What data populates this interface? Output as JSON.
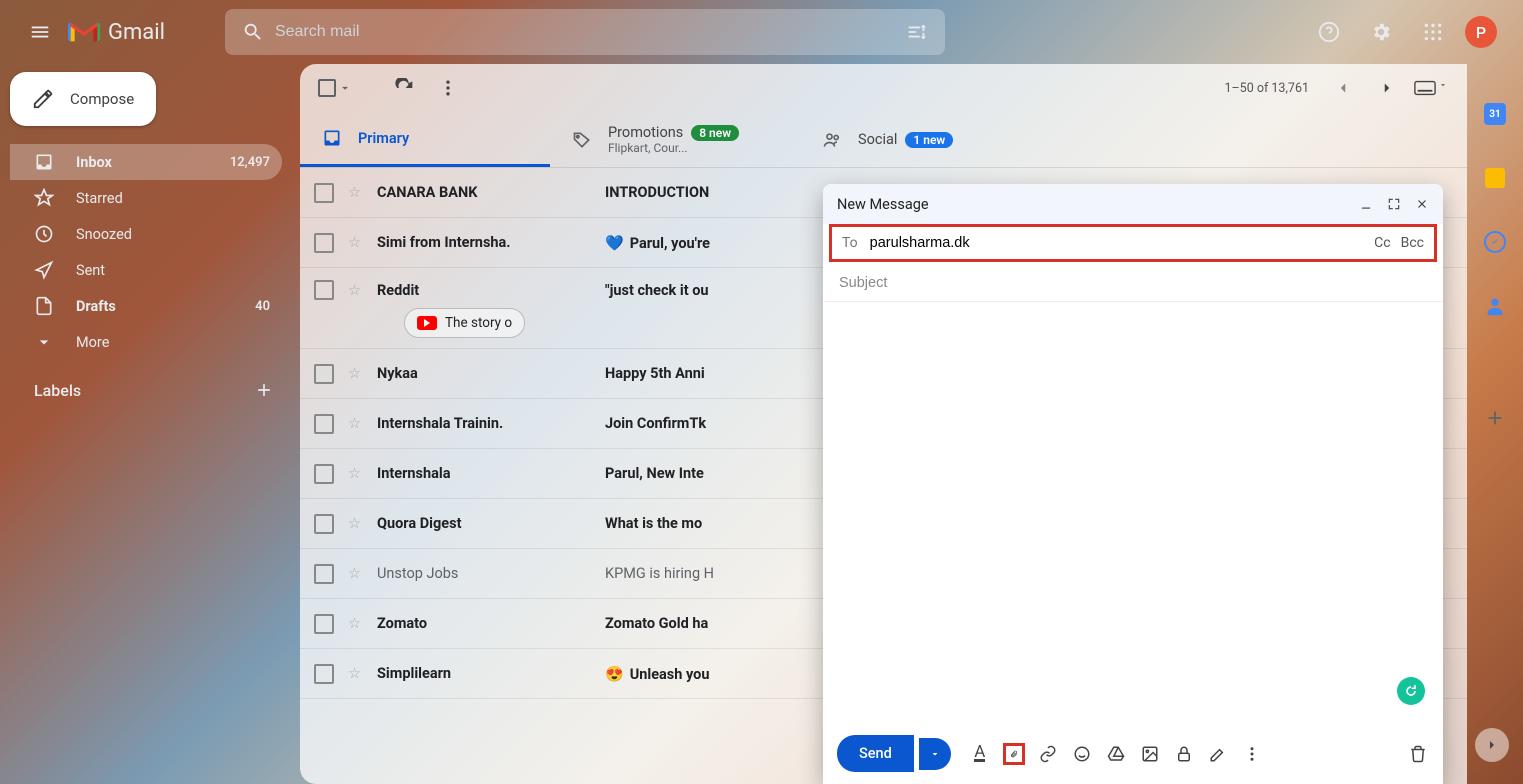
{
  "header": {
    "app_name": "Gmail",
    "search_placeholder": "Search mail",
    "avatar_letter": "P"
  },
  "sidebar": {
    "compose_label": "Compose",
    "items": [
      {
        "icon": "inbox",
        "label": "Inbox",
        "count": "12,497",
        "active": true,
        "bold": true
      },
      {
        "icon": "star",
        "label": "Starred",
        "count": "",
        "active": false,
        "bold": false
      },
      {
        "icon": "snooze",
        "label": "Snoozed",
        "count": "",
        "active": false,
        "bold": false
      },
      {
        "icon": "sent",
        "label": "Sent",
        "count": "",
        "active": false,
        "bold": false
      },
      {
        "icon": "drafts",
        "label": "Drafts",
        "count": "40",
        "active": false,
        "bold": true
      },
      {
        "icon": "more",
        "label": "More",
        "count": "",
        "active": false,
        "bold": false
      }
    ],
    "labels_heading": "Labels"
  },
  "toolbar": {
    "page_info": "1–50 of 13,761"
  },
  "tabs": [
    {
      "label": "Primary",
      "badge": "",
      "sub": "",
      "active": true
    },
    {
      "label": "Promotions",
      "badge": "8 new",
      "badge_color": "green",
      "sub": "Flipkart, Cour...",
      "active": false
    },
    {
      "label": "Social",
      "badge": "1 new",
      "badge_color": "blue",
      "sub": "",
      "active": false
    }
  ],
  "emails": [
    {
      "sender": "CANARA BANK",
      "subject": "INTRODUCTION",
      "emoji": "",
      "read": false
    },
    {
      "sender": "Simi from Internsha.",
      "subject": "Parul, you're",
      "emoji": "💙",
      "read": false
    },
    {
      "sender": "Reddit",
      "subject": "\"just check it ou",
      "emoji": "",
      "read": false,
      "chip": "The story o"
    },
    {
      "sender": "Nykaa",
      "subject": "Happy 5th Anni",
      "emoji": "",
      "read": false
    },
    {
      "sender": "Internshala Trainin.",
      "subject": "Join ConfirmTk",
      "emoji": "",
      "read": false
    },
    {
      "sender": "Internshala",
      "subject": "Parul, New Inte",
      "emoji": "",
      "read": false
    },
    {
      "sender": "Quora Digest",
      "subject": "What is the mo",
      "emoji": "",
      "read": false
    },
    {
      "sender": "Unstop Jobs",
      "subject": "KPMG is hiring H",
      "emoji": "",
      "read": true
    },
    {
      "sender": "Zomato",
      "subject": "Zomato Gold ha",
      "emoji": "",
      "read": false
    },
    {
      "sender": "Simplilearn",
      "subject": "Unleash you",
      "emoji": "😍",
      "read": false
    }
  ],
  "compose": {
    "title": "New Message",
    "to_label": "To",
    "to_value": "parulsharma.dk",
    "cc": "Cc",
    "bcc": "Bcc",
    "subject_placeholder": "Subject",
    "send_label": "Send"
  },
  "rail": {
    "calendar_day": "31"
  }
}
